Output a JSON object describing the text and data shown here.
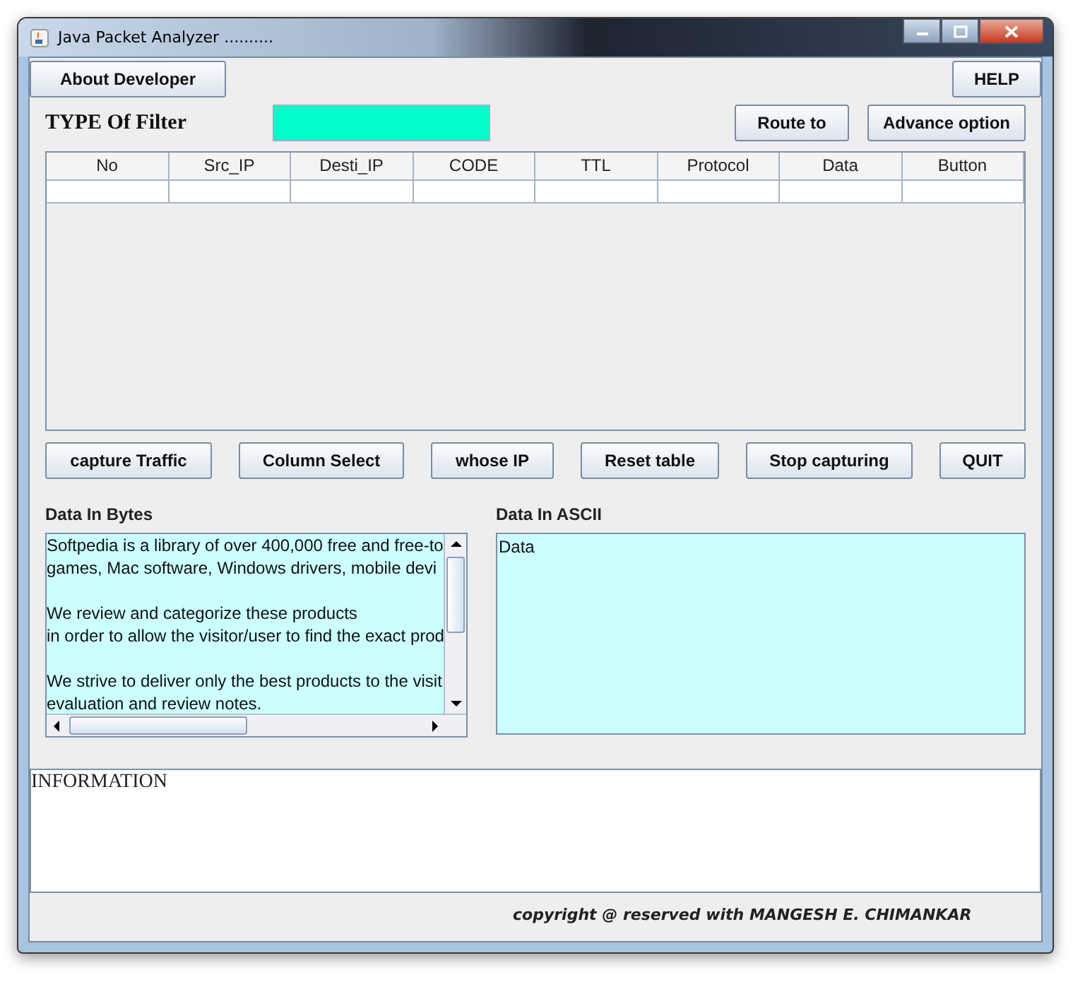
{
  "window": {
    "title": "Java Packet Analyzer .........."
  },
  "top_buttons": [
    {
      "label": "About Developer",
      "kind": "left"
    },
    {
      "label": "HELP",
      "kind": "right"
    }
  ],
  "filter": {
    "label": "TYPE Of Filter"
  },
  "filter_buttons": [
    "Route to",
    "Advance option"
  ],
  "table": {
    "columns": [
      "No",
      "Src_IP",
      "Desti_IP",
      "CODE",
      "TTL",
      "Protocol",
      "Data",
      "Button"
    ]
  },
  "action_buttons": [
    "capture Traffic",
    "Column Select",
    "whose IP",
    "Reset table",
    "Stop capturing",
    "QUIT"
  ],
  "bytes_panel": {
    "label": "Data In Bytes",
    "paragraphs": [
      [
        "Softpedia is a library of over 400,000 free and free-to",
        "games, Mac software, Windows drivers, mobile devi"
      ],
      [
        "We review and categorize these products",
        "in order to allow the visitor/user to find the exact prod"
      ],
      [
        "We strive to deliver only the best products to the visit",
        "evaluation and review notes."
      ]
    ]
  },
  "ascii_panel": {
    "label": "Data In ASCII",
    "value": "Data"
  },
  "information": {
    "value": "INFORMATION"
  },
  "copyright": "copyright @ reserved with MANGESH E. CHIMANKAR"
}
